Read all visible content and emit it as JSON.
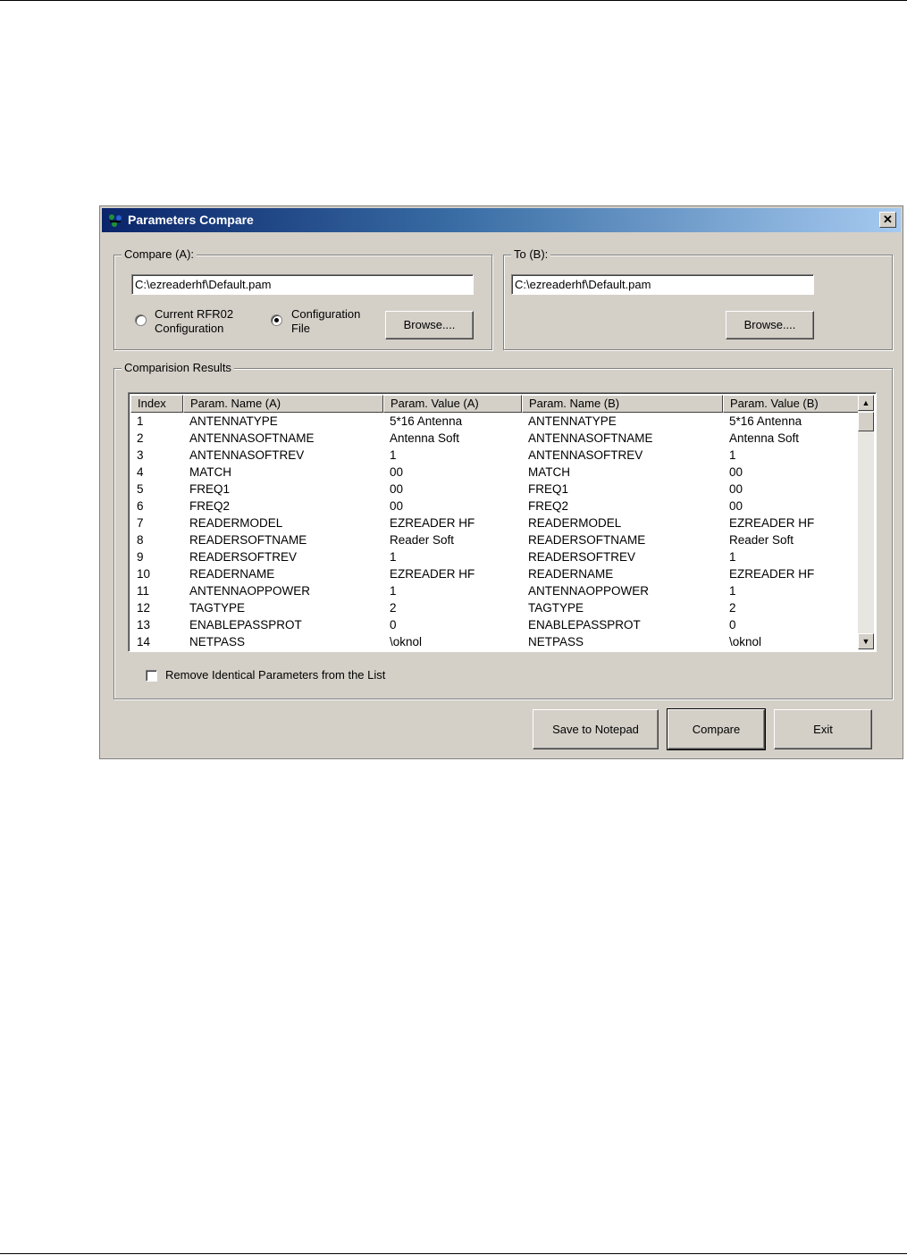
{
  "window": {
    "title": "Parameters Compare",
    "close_label": "✕"
  },
  "compare_a": {
    "legend": "Compare (A):",
    "path": "C:\\ezreaderhf\\Default.pam",
    "radio_current_line1": "Current RFR02",
    "radio_current_line2": "Configuration",
    "radio_file_line1": "Configuration",
    "radio_file_line2": "File",
    "selected": "Configuration File",
    "browse_label": "Browse...."
  },
  "to_b": {
    "legend": "To (B):",
    "path": "C:\\ezreaderhf\\Default.pam",
    "browse_label": "Browse...."
  },
  "results": {
    "legend": "Comparision Results",
    "columns": [
      "Index",
      "Param. Name (A)",
      "Param. Value (A)",
      "Param. Name (B)",
      "Param. Value (B)"
    ],
    "rows": [
      [
        "1",
        "ANTENNATYPE",
        "5*16 Antenna",
        "ANTENNATYPE",
        "5*16 Antenna"
      ],
      [
        "2",
        "ANTENNASOFTNAME",
        "Antenna Soft",
        "ANTENNASOFTNAME",
        "Antenna Soft"
      ],
      [
        "3",
        "ANTENNASOFTREV",
        "1",
        "ANTENNASOFTREV",
        "1"
      ],
      [
        "4",
        "MATCH",
        "00",
        "MATCH",
        "00"
      ],
      [
        "5",
        "FREQ1",
        "00",
        "FREQ1",
        "00"
      ],
      [
        "6",
        "FREQ2",
        "00",
        "FREQ2",
        "00"
      ],
      [
        "7",
        "READERMODEL",
        "EZREADER HF",
        "READERMODEL",
        "EZREADER HF"
      ],
      [
        "8",
        "READERSOFTNAME",
        "Reader Soft",
        "READERSOFTNAME",
        "Reader Soft"
      ],
      [
        "9",
        "READERSOFTREV",
        "1",
        "READERSOFTREV",
        "1"
      ],
      [
        "10",
        "READERNAME",
        "EZREADER HF",
        "READERNAME",
        "EZREADER HF"
      ],
      [
        "11",
        "ANTENNAOPPOWER",
        "1",
        "ANTENNAOPPOWER",
        "1"
      ],
      [
        "12",
        "TAGTYPE",
        "2",
        "TAGTYPE",
        "2"
      ],
      [
        "13",
        "ENABLEPASSPROT",
        "0",
        "ENABLEPASSPROT",
        "0"
      ],
      [
        "14",
        "NETPASS",
        "\\oknol",
        "NETPASS",
        "\\oknol"
      ]
    ],
    "remove_identical_label": "Remove Identical Parameters from the List",
    "remove_identical_checked": false
  },
  "buttons": {
    "save": "Save to Notepad",
    "compare": "Compare",
    "exit": "Exit"
  }
}
